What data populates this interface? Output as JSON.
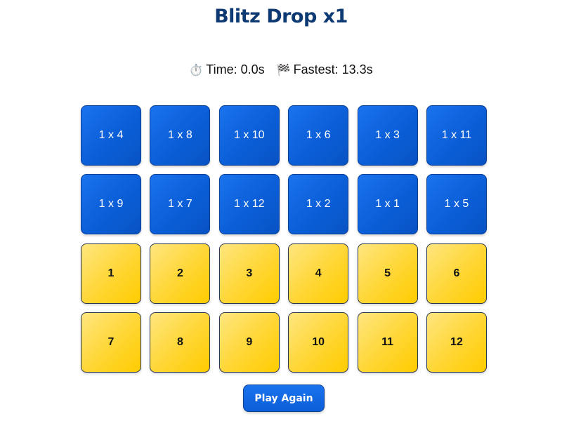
{
  "game": {
    "title": "Blitz Drop x1"
  },
  "stats": {
    "time_icon": "stopwatch-icon",
    "time_glyph": "⏱️",
    "time_text": "Time: 0.0s",
    "fastest_icon": "checkered-flag-icon",
    "fastest_glyph": "🏁",
    "fastest_text": "Fastest: 13.3s"
  },
  "problems": [
    "1 x 4",
    "1 x 8",
    "1 x 10",
    "1 x 6",
    "1 x 3",
    "1 x 11",
    "1 x 9",
    "1 x 7",
    "1 x 12",
    "1 x 2",
    "1 x 1",
    "1 x 5"
  ],
  "answers": [
    "1",
    "2",
    "3",
    "4",
    "5",
    "6",
    "7",
    "8",
    "9",
    "10",
    "11",
    "12"
  ],
  "actions": {
    "play_again_label": "Play Again"
  },
  "colors": {
    "title": "#0d3a73",
    "problem_tile": "#0b5ed7",
    "answer_tile": "#ffd633"
  }
}
